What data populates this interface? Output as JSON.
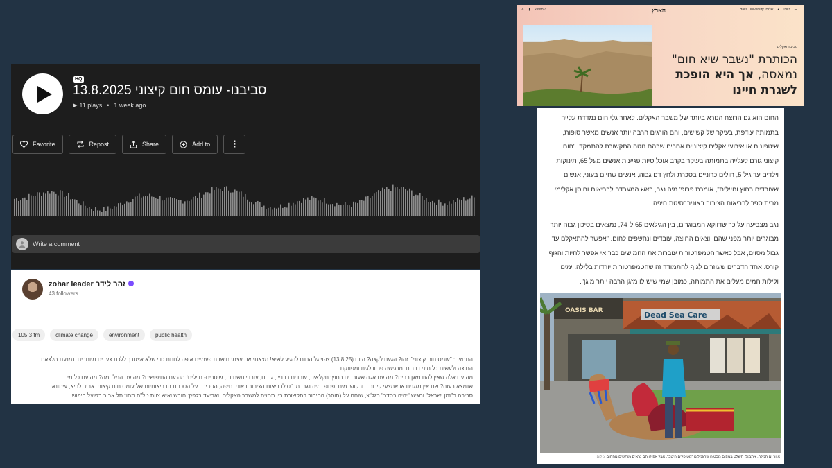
{
  "player": {
    "badge": "HQ",
    "title": "סביבנו- עומס חום קיצוני 13.8.2025",
    "plays": "11 plays",
    "time_ago": "1 week ago",
    "actions": {
      "favorite": "Favorite",
      "repost": "Repost",
      "share": "Share",
      "add_to": "Add to"
    },
    "comment_placeholder": "Write a comment"
  },
  "profile": {
    "name": "zohar leader זהר לידר",
    "followers": "43 followers",
    "tags": [
      "105.3 fm",
      "climate change",
      "environment",
      "public health"
    ],
    "description": [
      "התחזית: \"עומס חום קיצוני\". זהו? הגענו לקצה? היום (13.8.25) צפוי גל החום להגיע לשיא! מצאתי את עצמי חושבת פעמיים איפה לחנות כדי שלא אצטרך ללכת צעדים מיותרים. נמנעת מלצאת",
      "החוצה ולעשות כל מיני דברים. מרגישה פריווילגית ומפונקת.",
      "מה עם אלה שאין להם מזגן בבית? מה עם אלה שעובדים בחוץ: חקלאים, עובדים בבניין, גננים, עובדי תשתיות, שוטרים- חיילים! מה עם החיפושים? מה עם המלחמה? מה עם כל מי",
      "שנמצא בעזה? שם אין מזגנים או אמצעי קירור... ובקושי מים. פרופ. מיה נגב, מב\"ס לבריאות הציבור באוני. חיפה, הסבירה על הסכנות הבריאותיות של עומס חום קיצוני. אביב לביא, עיתונאי",
      "סביבה ב\"זמן ישראל\" ומגיש \"יהיה בסדר\" בגל\"צ, שוחח על (חוסר) החיבור בתקשורת בין תחזית למשבר האקלים. ואביעד בלפק: חובש ואיש צוות טל\"ח מחוז תל אביב בפועל חיפוש..."
    ]
  },
  "article": {
    "logo": "הארץ",
    "nav_left": [
      "חיפוש"
    ],
    "nav_right": [
      "ניווט",
      "שלום, Haifa University"
    ],
    "section": "סביבה ואקלים",
    "headline_1": "הכותרת \"נשבר שיא חום\"",
    "headline_2": "נמאסה,",
    "headline_2_bold": "אך היא הופכת",
    "headline_3_bold": "לשגרת חיינו",
    "paragraph_1": [
      "החום הוא גם הרוצח הנורא ביותר של משבר האקלים. לאחר גלי חום נמדדת עלייה",
      "בתמותה עודפת, בעיקר של קשישים, והם הורגים הרבה יותר אנשים מאשר סופות,",
      "שיטפונות או אירועי אקלים קיצוניים אחרים שבהם נוטה התקשורת להתמקד. \"חום",
      "קיצוני גורם לעלייה בתמותה בעיקר בקרב אוכלוסיות פגיעות אנשים מעל 65, תינוקות",
      "וילדים עד גיל 5, חולים כרוניים בסכרת ולחץ דם גבוה, אנשים שחיים בעוני, אנשים",
      "שעובדים בחוץ וחיילים\", אומרת פרופ' מיה נגב, ראש המעבדה לבריאות וחוסן אקלימי",
      "מבית ספר לבריאות הציבור באוניברסיטת חיפה."
    ],
    "paragraph_2": [
      "נגב מצביעה על כך שדווקא המבוגרים, בין הגילאים 65 ל־74, נמצאים בסיכון גבוה יותר",
      "מבוגרים יותר מפני שהם יוצאים החוצה, עובדים ונחשפים לחום. \"אפשר להתאקלם עד",
      "גבול מסוים, אבל כאשר הטמפרטורות עוברות את החמישים כבר אי אפשר לחיות והגוף",
      "קורס. אחד הדברים שעוזרים לגוף להתמודד זה שהטמפרטורות יורדות בלילה. ימים",
      "ולילות חמים מעלים את התמותה, כמובן שמי שיש לו מזגן הרבה יותר מוגן\"."
    ],
    "photo_signs": [
      "OASIS BAR",
      "Dead Sea Care"
    ],
    "caption": "אזור ים המלח, אתמול. השלט במקום מבטיח שהגמלים \"מטופלים היטב\", אבל אפילו הם נראים מותשים מהחום",
    "credit": "צילום"
  },
  "colors": {
    "background": "#223344",
    "player_bg": "#1d1d1d",
    "verified": "#7b4dff"
  }
}
